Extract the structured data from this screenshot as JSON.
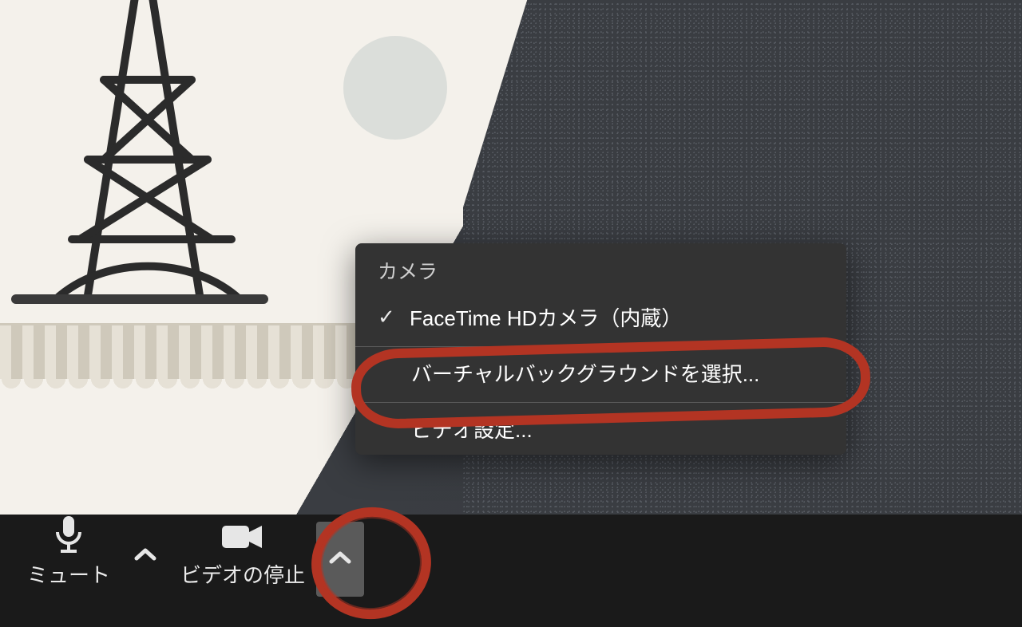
{
  "menu": {
    "section_label": "カメラ",
    "items": [
      {
        "label": "FaceTime HDカメラ（内蔵）",
        "checked": true
      },
      {
        "label": "バーチャルバックグラウンドを選択..."
      },
      {
        "label": "ビデオ設定..."
      }
    ]
  },
  "toolbar": {
    "mute_label": "ミュート",
    "stop_video_label": "ビデオの停止"
  },
  "annotation": {
    "target_caret": "video-options-caret",
    "target_menu_item": "menu-item-virtual-background"
  }
}
